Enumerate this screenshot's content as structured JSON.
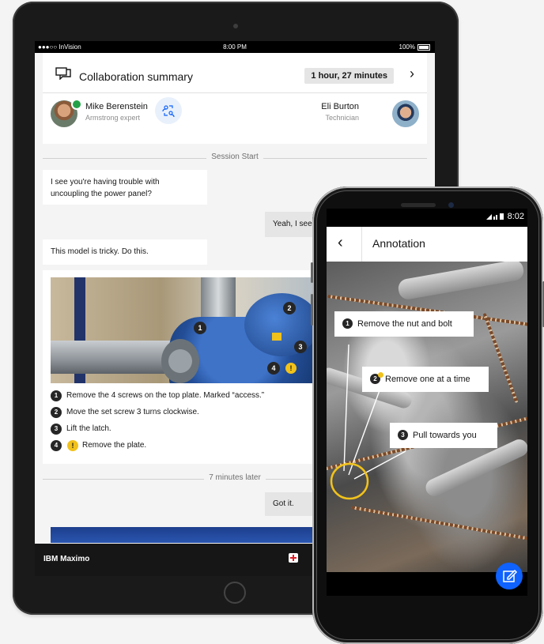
{
  "tablet": {
    "status": {
      "carrier": "●●●○○ InVision",
      "time": "8:00 PM",
      "battery": "100%"
    },
    "summary": {
      "title": "Collaboration summary",
      "duration": "1 hour, 27 minutes",
      "expert": {
        "name": "Mike Berenstein",
        "role": "Armstrong expert"
      },
      "technician": {
        "name": "Eli Burton",
        "role": "Technician"
      }
    },
    "chat": {
      "session_start": "Session Start",
      "msg1": "I see you're having trouble with uncoupling the power panel?",
      "reply1": "Yeah, I see",
      "msg2": "This model is tricky. Do this.",
      "photo_markers": [
        "1",
        "2",
        "3",
        "4"
      ],
      "steps": [
        {
          "num": "1",
          "text": "Remove the 4 screws on the top plate. Marked “access.”"
        },
        {
          "num": "2",
          "text": "Move the set screw 3 turns clockwise."
        },
        {
          "num": "3",
          "text": "Lift the latch."
        },
        {
          "num": "4",
          "text": "Remove the plate."
        }
      ],
      "warning_glyph": "!",
      "later": "7 minutes later",
      "reply2": "Got it."
    },
    "brand": "IBM Maximo"
  },
  "phone": {
    "status": {
      "time": "8:02"
    },
    "title": "Annotation",
    "callouts": [
      {
        "num": "1",
        "text": "Remove the nut and bolt"
      },
      {
        "num": "2",
        "text": "Remove one at a time"
      },
      {
        "num": "3",
        "text": "Pull towards you"
      }
    ]
  },
  "colors": {
    "accent": "#0f62fe",
    "warning": "#f1c21b",
    "online": "#24a148",
    "highlight": "#f1c21b"
  },
  "icons": [
    "chat-summary-icon",
    "chevron-right-icon",
    "swap-users-icon",
    "plus-icon",
    "back-arrow-icon",
    "edit-icon",
    "signal-icon",
    "battery-icon",
    "warning-icon"
  ]
}
